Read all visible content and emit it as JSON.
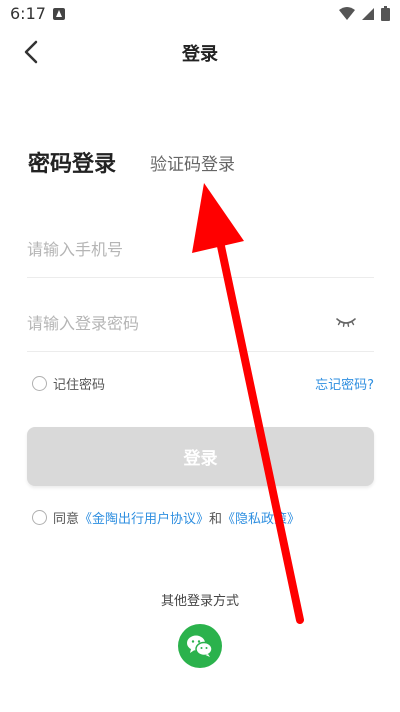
{
  "status_bar": {
    "time": "6:17",
    "icons": [
      "notification-icon",
      "wifi-icon",
      "signal-icon",
      "battery-icon"
    ]
  },
  "header": {
    "back_icon": "chevron-left-icon",
    "title": "登录"
  },
  "tabs": {
    "password_login": "密码登录",
    "code_login": "验证码登录"
  },
  "form": {
    "phone_placeholder": "请输入手机号",
    "phone_value": "",
    "password_placeholder": "请输入登录密码",
    "password_value": "",
    "password_toggle_icon": "eye-closed-icon",
    "remember_label": "记住密码",
    "remember_checked": false,
    "forgot_link": "忘记密码?",
    "login_button": "登录"
  },
  "agreement": {
    "checked": false,
    "prefix": "同意",
    "user_agreement": "《金陶出行用户协议》",
    "conjunction": "和",
    "privacy_policy": "《隐私政策》"
  },
  "other_login": {
    "title": "其他登录方式",
    "wechat_icon": "wechat-icon"
  },
  "colors": {
    "link": "#2f8fe0",
    "button_disabled": "#d9d9d9",
    "wechat": "#2bb24c",
    "annotation_arrow": "#ff0000"
  }
}
